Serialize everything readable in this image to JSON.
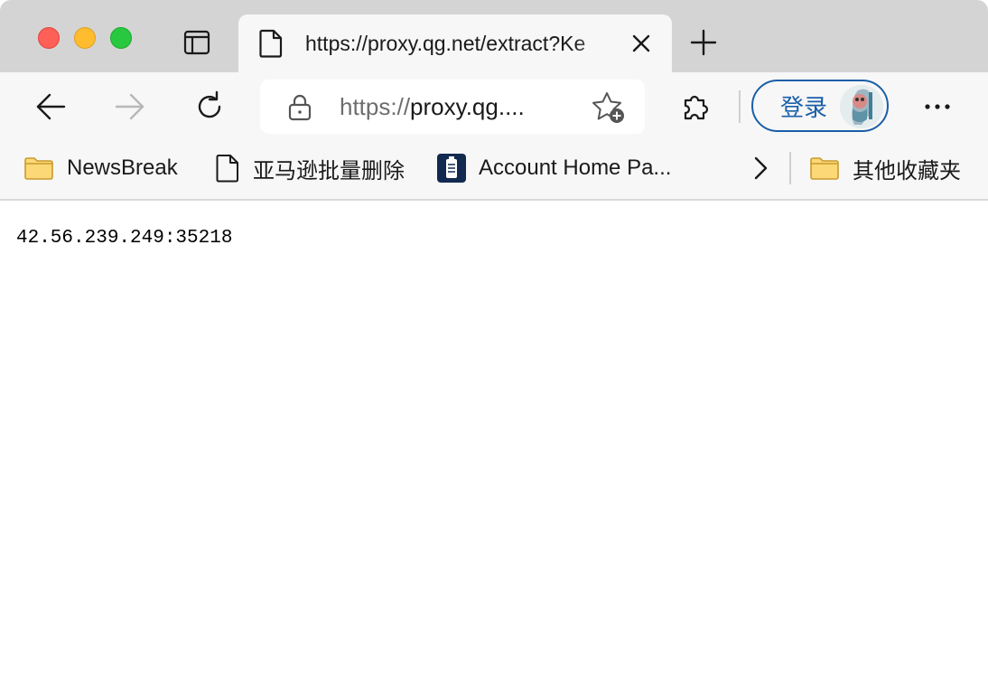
{
  "window": {
    "colors": {
      "close": "#fe5f57",
      "minimize": "#febc2e",
      "maximize": "#28c840"
    }
  },
  "tab": {
    "title": "https://proxy.qg.net/extract?Ke",
    "icons": {
      "page": "page-icon",
      "close": "close-icon",
      "new_tab": "plus-icon",
      "tab_actions": "tab-actions-icon"
    }
  },
  "toolbar": {
    "address": {
      "scheme": "https://",
      "rest": "proxy.qg...."
    },
    "login_label": "登录",
    "icons": {
      "back": "arrow-left-icon",
      "forward": "arrow-right-icon",
      "refresh": "refresh-icon",
      "lock": "lock-icon",
      "favorite": "star-add-icon",
      "extensions": "puzzle-icon",
      "more": "more-icon"
    },
    "accent": "#1a5fa8"
  },
  "bookmarks": {
    "items": [
      {
        "label": "NewsBreak",
        "icon": "folder-icon"
      },
      {
        "label": "亚马逊批量删除",
        "icon": "page-icon"
      },
      {
        "label": "Account Home Pa...",
        "icon": "bookmark-favicon-icon"
      }
    ],
    "overflow_icon": "chevron-right-icon",
    "other": {
      "label": "其他收藏夹",
      "icon": "folder-icon"
    }
  },
  "content": {
    "text": "42.56.239.249:35218"
  }
}
